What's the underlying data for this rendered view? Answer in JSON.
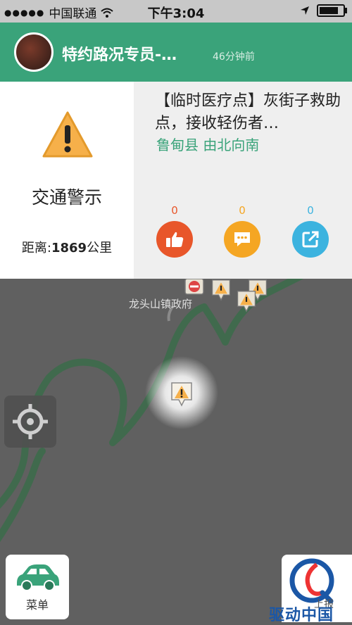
{
  "status": {
    "carrier": "中国联通",
    "time": "下午3:04",
    "battery_level": 0.85
  },
  "header": {
    "title": "特约路况专员-…",
    "time_ago": "46分钟前"
  },
  "alert": {
    "type": "交通警示",
    "distance_label": "距离:",
    "distance_value": "1869",
    "distance_unit": "公里",
    "description": "【临时医疗点】灰街子救助点，接收轻伤者…",
    "location": "鲁甸县  由北向南",
    "likes": "0",
    "comments": "0",
    "shares": "0"
  },
  "map": {
    "place_label": "龙头山镇政府"
  },
  "bottom": {
    "menu_label": "菜单",
    "report_label": "上报",
    "watermark": "驱动中国"
  },
  "colors": {
    "brand_green": "#3aa37a",
    "like_red": "#e8562a",
    "comment_orange": "#f5a623",
    "share_blue": "#3cb3df"
  }
}
